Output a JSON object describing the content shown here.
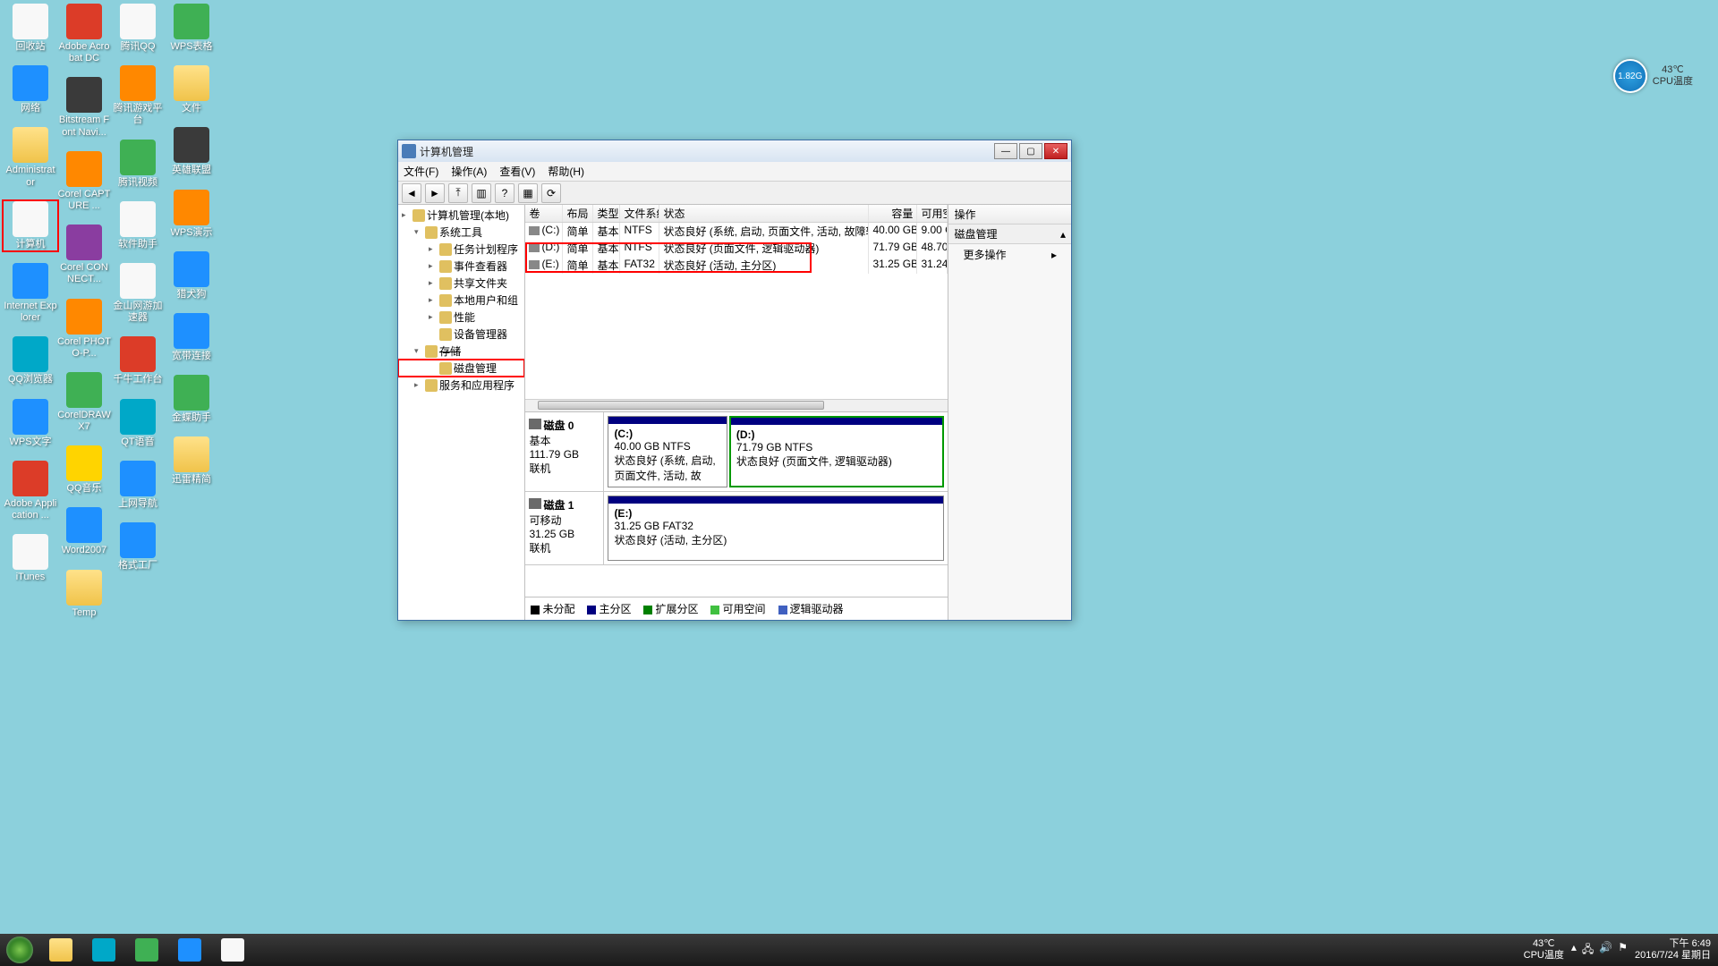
{
  "desktop_icons": [
    [
      {
        "label": "回收站",
        "cls": "ic-white"
      },
      {
        "label": "网络",
        "cls": "ic-blue"
      },
      {
        "label": "Administrator",
        "cls": "ic-folder"
      },
      {
        "label": "计算机",
        "cls": "ic-white",
        "selected": true
      },
      {
        "label": "Internet Explorer",
        "cls": "ic-blue"
      },
      {
        "label": "QQ浏览器",
        "cls": "ic-teal"
      },
      {
        "label": "WPS文字",
        "cls": "ic-blue"
      },
      {
        "label": "Adobe Application ...",
        "cls": "ic-red"
      },
      {
        "label": "iTunes",
        "cls": "ic-white"
      }
    ],
    [
      {
        "label": "Adobe Acrobat DC",
        "cls": "ic-red"
      },
      {
        "label": "Bitstream Font Navi...",
        "cls": "ic-dark"
      },
      {
        "label": "Corel CAPTURE ...",
        "cls": "ic-orange"
      },
      {
        "label": "Corel CONNECT...",
        "cls": "ic-purple"
      },
      {
        "label": "Corel PHOTO-P...",
        "cls": "ic-orange"
      },
      {
        "label": "CorelDRAW X7",
        "cls": "ic-green"
      },
      {
        "label": "QQ音乐",
        "cls": "ic-yellow"
      },
      {
        "label": "Word2007",
        "cls": "ic-blue"
      },
      {
        "label": "Temp",
        "cls": "ic-folder"
      }
    ],
    [
      {
        "label": "腾讯QQ",
        "cls": "ic-white"
      },
      {
        "label": "腾讯游戏平台",
        "cls": "ic-orange"
      },
      {
        "label": "腾讯视频",
        "cls": "ic-green"
      },
      {
        "label": "软件助手",
        "cls": "ic-white"
      },
      {
        "label": "金山网游加速器",
        "cls": "ic-white"
      },
      {
        "label": "千牛工作台",
        "cls": "ic-red"
      },
      {
        "label": "QT语音",
        "cls": "ic-teal"
      },
      {
        "label": "上网导航",
        "cls": "ic-blue"
      },
      {
        "label": "格式工厂",
        "cls": "ic-blue"
      }
    ],
    [
      {
        "label": "WPS表格",
        "cls": "ic-green"
      },
      {
        "label": "文件",
        "cls": "ic-folder"
      },
      {
        "label": "英雄联盟",
        "cls": "ic-dark"
      },
      {
        "label": "WPS演示",
        "cls": "ic-orange"
      },
      {
        "label": "猎犬狗",
        "cls": "ic-blue"
      },
      {
        "label": "宽带连接",
        "cls": "ic-blue"
      },
      {
        "label": "金蝶助手",
        "cls": "ic-green"
      },
      {
        "label": "迅雷精简",
        "cls": "ic-folder"
      }
    ]
  ],
  "cpu_widget": {
    "badge": "1.82G",
    "temp": "43℃",
    "label": "CPU温度"
  },
  "window": {
    "title": "计算机管理",
    "menu": [
      "文件(F)",
      "操作(A)",
      "查看(V)",
      "帮助(H)"
    ],
    "tree": [
      {
        "label": "计算机管理(本地)",
        "indent": 0,
        "exp": "▸"
      },
      {
        "label": "系统工具",
        "indent": 1,
        "exp": "▾"
      },
      {
        "label": "任务计划程序",
        "indent": 2,
        "exp": "▸"
      },
      {
        "label": "事件查看器",
        "indent": 2,
        "exp": "▸"
      },
      {
        "label": "共享文件夹",
        "indent": 2,
        "exp": "▸"
      },
      {
        "label": "本地用户和组",
        "indent": 2,
        "exp": "▸"
      },
      {
        "label": "性能",
        "indent": 2,
        "exp": "▸"
      },
      {
        "label": "设备管理器",
        "indent": 2,
        "exp": ""
      },
      {
        "label": "存储",
        "indent": 1,
        "exp": "▾",
        "strike": true
      },
      {
        "label": "磁盘管理",
        "indent": 2,
        "exp": "",
        "selected": true
      },
      {
        "label": "服务和应用程序",
        "indent": 1,
        "exp": "▸"
      }
    ],
    "vol_headers": [
      "卷",
      "布局",
      "类型",
      "文件系统",
      "状态",
      "容量",
      "可用空"
    ],
    "volumes": [
      {
        "drv": "(C:)",
        "layout": "简单",
        "type": "基本",
        "fs": "NTFS",
        "status": "状态良好 (系统, 启动, 页面文件, 活动, 故障转储, 主分区)",
        "cap": "40.00 GB",
        "free": "9.00 G"
      },
      {
        "drv": "(D:)",
        "layout": "简单",
        "type": "基本",
        "fs": "NTFS",
        "status": "状态良好 (页面文件, 逻辑驱动器)",
        "cap": "71.79 GB",
        "free": "48.70"
      },
      {
        "drv": "(E:)",
        "layout": "简单",
        "type": "基本",
        "fs": "FAT32",
        "status": "状态良好 (活动, 主分区)",
        "cap": "31.25 GB",
        "free": "31.24"
      }
    ],
    "disks": [
      {
        "name": "磁盘 0",
        "type": "基本",
        "size": "111.79 GB",
        "state": "联机",
        "parts": [
          {
            "label": "(C:)",
            "line2": "40.00 GB NTFS",
            "line3": "状态良好 (系统, 启动, 页面文件, 活动, 故",
            "flex": 40
          },
          {
            "label": "(D:)",
            "line2": "71.79 GB NTFS",
            "line3": "状态良好 (页面文件, 逻辑驱动器)",
            "flex": 72,
            "selected": true
          }
        ]
      },
      {
        "name": "磁盘 1",
        "type": "可移动",
        "size": "31.25 GB",
        "state": "联机",
        "parts": [
          {
            "label": "(E:)",
            "line2": "31.25 GB FAT32",
            "line3": "状态良好 (活动, 主分区)",
            "flex": 100
          }
        ]
      }
    ],
    "legend": [
      {
        "c": "#000",
        "t": "未分配"
      },
      {
        "c": "#000080",
        "t": "主分区"
      },
      {
        "c": "#008000",
        "t": "扩展分区"
      },
      {
        "c": "#40c040",
        "t": "可用空间"
      },
      {
        "c": "#4060c0",
        "t": "逻辑驱动器"
      }
    ],
    "actions": {
      "header": "操作",
      "section": "磁盘管理",
      "more": "更多操作"
    }
  },
  "taskbar": {
    "items": [
      {
        "cls": "ic-folder"
      },
      {
        "cls": "ic-teal"
      },
      {
        "cls": "ic-green"
      },
      {
        "cls": "ic-blue"
      },
      {
        "cls": "ic-white"
      }
    ],
    "temp": "43℃",
    "temp_label": "CPU温度",
    "time": "下午 6:49",
    "date": "2016/7/24 星期日"
  }
}
